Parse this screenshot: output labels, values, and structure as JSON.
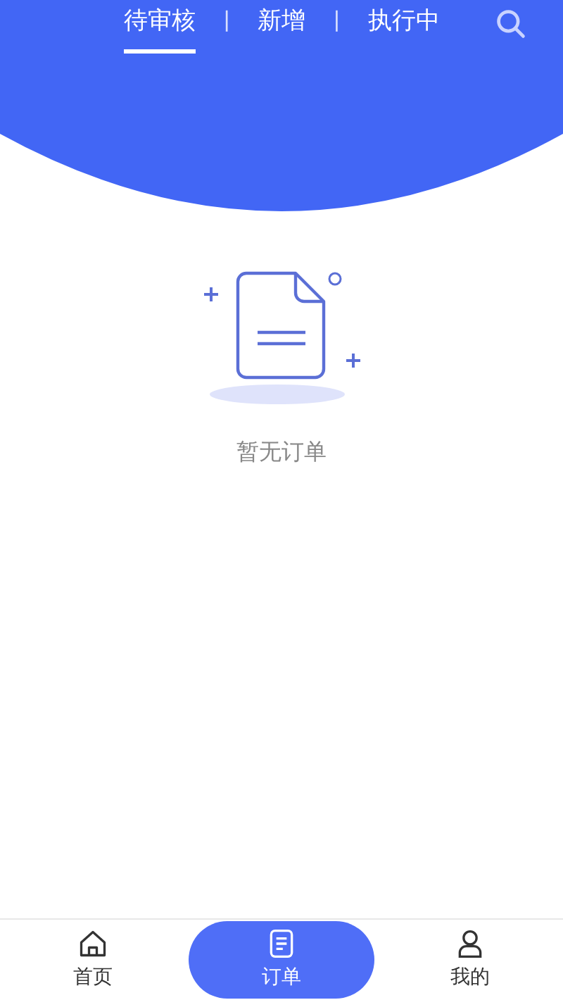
{
  "tabs": [
    {
      "label": "待审核",
      "selected": true
    },
    {
      "label": "新增",
      "selected": false
    },
    {
      "label": "执行中",
      "selected": false
    }
  ],
  "separator": "|",
  "empty_state": {
    "message": "暂无订单"
  },
  "bottom_nav": [
    {
      "label": "首页",
      "kind": "home",
      "selected": false
    },
    {
      "label": "订单",
      "kind": "orders",
      "selected": true
    },
    {
      "label": "我的",
      "kind": "profile",
      "selected": false
    }
  ]
}
